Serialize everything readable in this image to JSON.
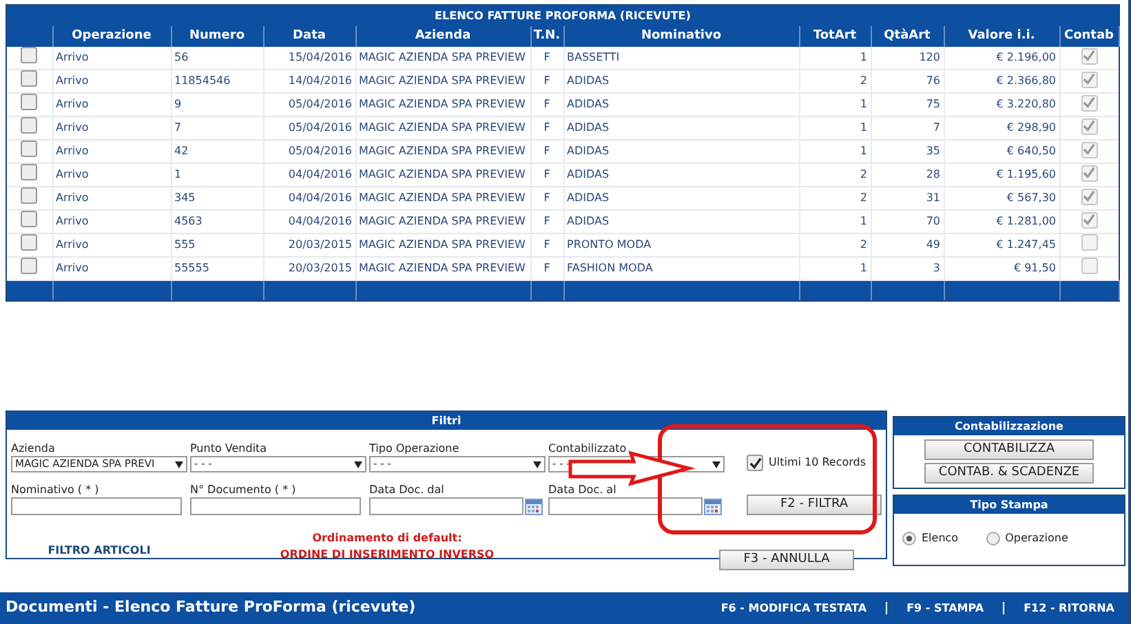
{
  "table": {
    "title": "ELENCO FATTURE PROFORMA (RICEVUTE)",
    "columns": [
      "Operazione",
      "Numero",
      "Data",
      "Azienda",
      "T.N.",
      "Nominativo",
      "TotArt",
      "QtàArt",
      "Valore i.i.",
      "Contab"
    ],
    "rows": [
      {
        "checked": false,
        "cells": [
          "Arrivo",
          "56",
          "15/04/2016",
          "MAGIC AZIENDA SPA PREVIEW",
          "F",
          "BASSETTI",
          "1",
          "120",
          "€ 2.196,00"
        ],
        "contab": true
      },
      {
        "checked": false,
        "cells": [
          "Arrivo",
          "11854546",
          "14/04/2016",
          "MAGIC AZIENDA SPA PREVIEW",
          "F",
          "ADIDAS",
          "2",
          "76",
          "€ 2.366,80"
        ],
        "contab": true
      },
      {
        "checked": false,
        "cells": [
          "Arrivo",
          "9",
          "05/04/2016",
          "MAGIC AZIENDA SPA PREVIEW",
          "F",
          "ADIDAS",
          "1",
          "75",
          "€ 3.220,80"
        ],
        "contab": true
      },
      {
        "checked": false,
        "cells": [
          "Arrivo",
          "7",
          "05/04/2016",
          "MAGIC AZIENDA SPA PREVIEW",
          "F",
          "ADIDAS",
          "1",
          "7",
          "€ 298,90"
        ],
        "contab": true
      },
      {
        "checked": false,
        "cells": [
          "Arrivo",
          "42",
          "05/04/2016",
          "MAGIC AZIENDA SPA PREVIEW",
          "F",
          "ADIDAS",
          "1",
          "35",
          "€ 640,50"
        ],
        "contab": true
      },
      {
        "checked": false,
        "cells": [
          "Arrivo",
          "1",
          "04/04/2016",
          "MAGIC AZIENDA SPA PREVIEW",
          "F",
          "ADIDAS",
          "2",
          "28",
          "€ 1.195,60"
        ],
        "contab": true
      },
      {
        "checked": false,
        "cells": [
          "Arrivo",
          "345",
          "04/04/2016",
          "MAGIC AZIENDA SPA PREVIEW",
          "F",
          "ADIDAS",
          "2",
          "31",
          "€ 567,30"
        ],
        "contab": true
      },
      {
        "checked": false,
        "cells": [
          "Arrivo",
          "4563",
          "04/04/2016",
          "MAGIC AZIENDA SPA PREVIEW",
          "F",
          "ADIDAS",
          "1",
          "70",
          "€ 1.281,00"
        ],
        "contab": true
      },
      {
        "checked": false,
        "cells": [
          "Arrivo",
          "555",
          "20/03/2015",
          "MAGIC AZIENDA SPA PREVIEW",
          "F",
          "PRONTO MODA",
          "2",
          "49",
          "€ 1.247,45"
        ],
        "contab": false
      },
      {
        "checked": false,
        "cells": [
          "Arrivo",
          "55555",
          "20/03/2015",
          "MAGIC AZIENDA SPA PREVIEW",
          "F",
          "FASHION MODA",
          "1",
          "3",
          "€ 91,50"
        ],
        "contab": false
      }
    ]
  },
  "filters": {
    "title": "Filtri",
    "selects": [
      {
        "label": "Azienda",
        "value": "MAGIC AZIENDA SPA PREVI"
      },
      {
        "label": "Punto Vendita",
        "value": "- - -"
      },
      {
        "label": "Tipo Operazione",
        "value": "- - -"
      },
      {
        "label": "Contabilizzato",
        "value": "- - -"
      }
    ],
    "fields": [
      {
        "label": "Nominativo ( * )",
        "kind": "text"
      },
      {
        "label": "N° Documento ( * )",
        "kind": "text"
      },
      {
        "label": "Data Doc. dal",
        "kind": "date"
      },
      {
        "label": "Data Doc. al",
        "kind": "date"
      }
    ],
    "last_records": {
      "label": "Ultimi 10 Records",
      "checked": true
    },
    "filter_button": "F2 - FILTRA",
    "cancel_button": "F3 - ANNULLA",
    "articles_link": "FILTRO ARTICOLI",
    "order_title": "Ordinamento di default:",
    "order_value": "ORDINE DI INSERIMENTO INVERSO"
  },
  "contabilizzazione": {
    "title": "Contabilizzazione",
    "buttons": [
      "CONTABILIZZA",
      "CONTAB. & SCADENZE"
    ]
  },
  "tipo_stampa": {
    "title": "Tipo Stampa",
    "options": [
      {
        "label": "Elenco",
        "selected": true
      },
      {
        "label": "Operazione",
        "selected": false
      }
    ]
  },
  "status_bar": {
    "title": "Documenti - Elenco Fatture ProForma (ricevute)",
    "actions": [
      "F6 - MODIFICA TESTATA",
      "F9 - STAMPA",
      "F12 - RITORNA"
    ]
  }
}
